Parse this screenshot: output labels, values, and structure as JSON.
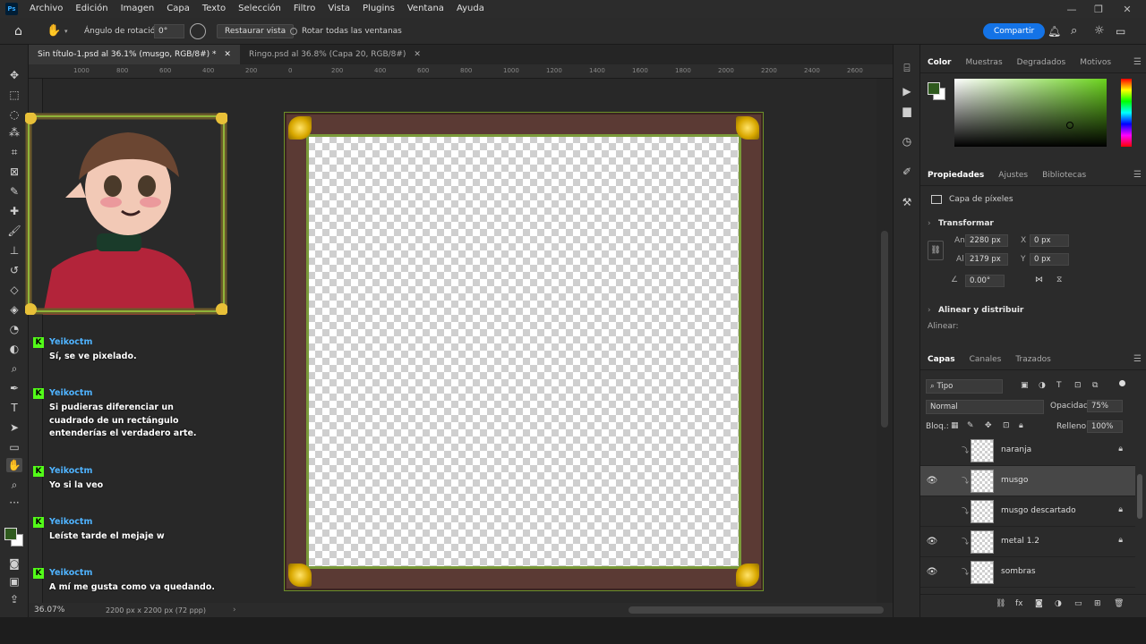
{
  "menubar": {
    "items": [
      "Archivo",
      "Edición",
      "Imagen",
      "Capa",
      "Texto",
      "Selección",
      "Filtro",
      "Vista",
      "Plugins",
      "Ventana",
      "Ayuda"
    ],
    "logo": "Ps"
  },
  "options": {
    "rotation_label": "Ángulo de rotación:",
    "rotation_value": "0°",
    "reset_view": "Restaurar vista",
    "rotate_all": "Rotar todas las ventanas",
    "share": "Compartir"
  },
  "tabs": [
    {
      "label": "Sin título-1.psd al 36.1% (musgo, RGB/8#) *"
    },
    {
      "label": "Ringo.psd al 36.8% (Capa 20, RGB/8#)"
    }
  ],
  "ruler": [
    "1000",
    "800",
    "600",
    "400",
    "200",
    "0",
    "200",
    "400",
    "600",
    "800",
    "1000",
    "1200",
    "1400",
    "1600",
    "1800",
    "2000",
    "2200",
    "2400",
    "2600"
  ],
  "status": {
    "zoom": "36.07%",
    "doc_size": "2200 px x 2200 px (72 ppp)"
  },
  "chat": [
    {
      "user": "Yeikoctm",
      "text": "Sí, se ve pixelado."
    },
    {
      "user": "Yeikoctm",
      "text": "Si pudieras diferenciar un cuadrado de un rectángulo entenderías el verdadero arte."
    },
    {
      "user": "Yeikoctm",
      "text": "Yo si la veo"
    },
    {
      "user": "Yeikoctm",
      "text": "Leíste tarde el mejaje w"
    },
    {
      "user": "Yeikoctm",
      "text": "A mí me gusta como va quedando."
    }
  ],
  "color_panel": {
    "tabs": [
      "Color",
      "Muestras",
      "Degradados",
      "Motivos"
    ],
    "foreground": "#2f5a1e"
  },
  "properties": {
    "tabs": [
      "Propiedades",
      "Ajustes",
      "Bibliotecas"
    ],
    "type_label": "Capa de píxeles",
    "transform_title": "Transformar",
    "an_label": "An",
    "an_value": "2280 px",
    "al_label": "Al",
    "al_value": "2179 px",
    "x_label": "X",
    "x_value": "0 px",
    "y_label": "Y",
    "y_value": "0 px",
    "angle_value": "0.00°",
    "align_title": "Alinear y distribuir",
    "align_label": "Alinear:"
  },
  "layers": {
    "tabs": [
      "Capas",
      "Canales",
      "Trazados"
    ],
    "filter": "Tipo",
    "blend": "Normal",
    "opacity_label": "Opacidad:",
    "opacity_value": "75%",
    "lock_label": "Bloq.:",
    "fill_label": "Relleno:",
    "fill_value": "100%",
    "items": [
      {
        "name": "naranja"
      },
      {
        "name": "musgo"
      },
      {
        "name": "musgo descartado"
      },
      {
        "name": "metal 1.2"
      },
      {
        "name": "sombras"
      }
    ]
  }
}
